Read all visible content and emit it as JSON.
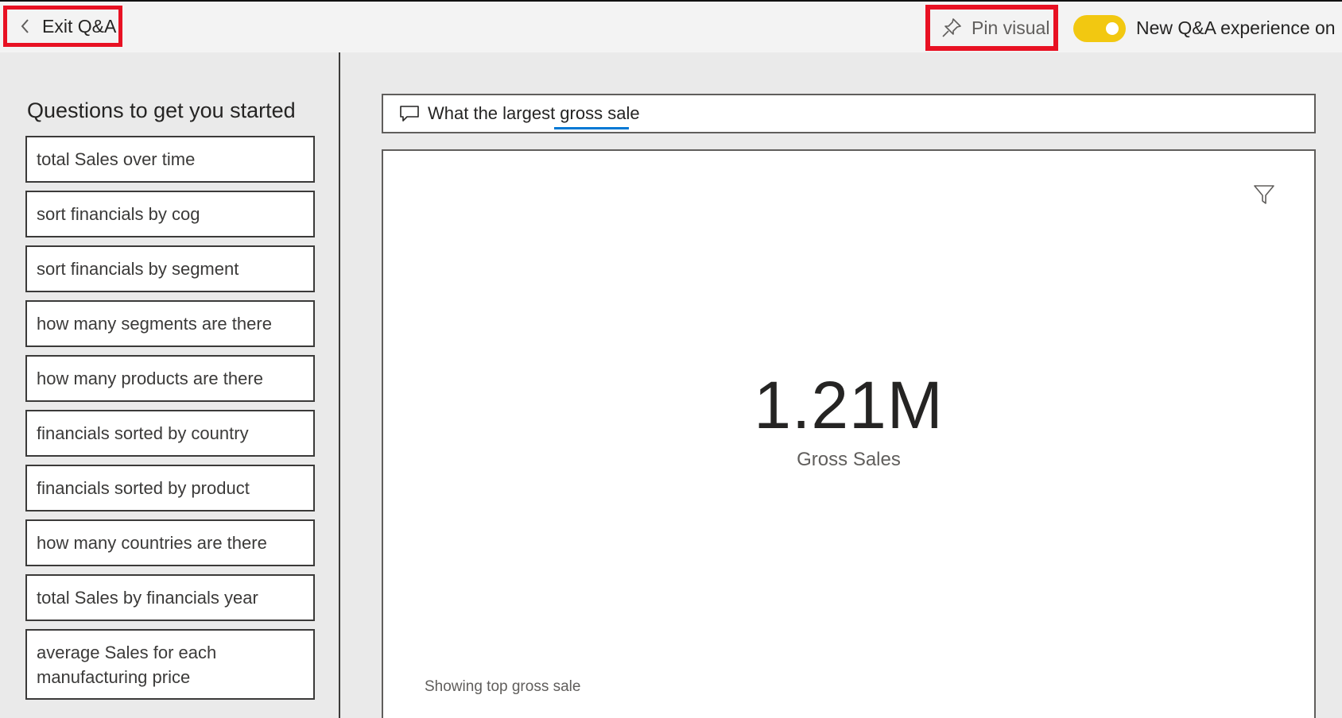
{
  "topbar": {
    "exit_label": "Exit Q&A",
    "exit_icon": "chevron-left-icon",
    "pin_label": "Pin visual",
    "pin_icon": "pin-icon",
    "toggle_label": "New Q&A experience on",
    "toggle_state": "on",
    "toggle_color": "#f2c811",
    "highlight_color": "#e81123"
  },
  "sidebar": {
    "title": "Questions to get you started",
    "questions": [
      "total Sales over time",
      "sort financials by cog",
      "sort financials by segment",
      "how many segments are there",
      "how many products are there",
      "financials sorted by country",
      "financials sorted by product",
      "how many countries are there",
      "total Sales by financials year",
      "average Sales for each manufacturing price"
    ]
  },
  "search": {
    "icon": "chat-bubble-icon",
    "value": "What the largest gross sale",
    "underline_color": "#0078d4"
  },
  "visual": {
    "filter_icon": "filter-icon",
    "kpi_value": "1.21M",
    "kpi_label": "Gross Sales",
    "footnote": "Showing top gross sale"
  }
}
